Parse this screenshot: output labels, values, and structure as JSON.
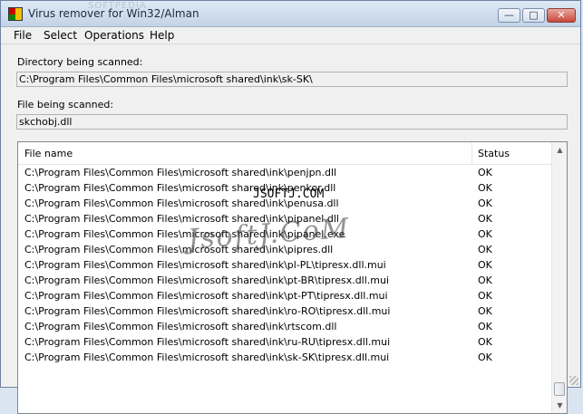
{
  "window": {
    "title": "Virus remover for Win32/Alman",
    "title_watermark": "SOFTPEDIA",
    "buttons": {
      "minimize": "—",
      "maximize": "□",
      "close": "✕"
    }
  },
  "menu": {
    "items": [
      "File",
      "Select",
      "Operations",
      "Help"
    ]
  },
  "scan": {
    "dir_label": "Directory being scanned:",
    "dir_value": "C:\\Program Files\\Common Files\\microsoft shared\\ink\\sk-SK\\",
    "file_label": "File being scanned:",
    "file_value": "skchobj.dll"
  },
  "list": {
    "columns": {
      "name": "File name",
      "status": "Status"
    },
    "rows": [
      {
        "name": "C:\\Program Files\\Common Files\\microsoft shared\\ink\\penjpn.dll",
        "status": "OK"
      },
      {
        "name": "C:\\Program Files\\Common Files\\microsoft shared\\ink\\penkor.dll",
        "status": "OK"
      },
      {
        "name": "C:\\Program Files\\Common Files\\microsoft shared\\ink\\penusa.dll",
        "status": "OK"
      },
      {
        "name": "C:\\Program Files\\Common Files\\microsoft shared\\ink\\pipanel.dll",
        "status": "OK"
      },
      {
        "name": "C:\\Program Files\\Common Files\\microsoft shared\\ink\\pipanel.exe",
        "status": "OK"
      },
      {
        "name": "C:\\Program Files\\Common Files\\microsoft shared\\ink\\pipres.dll",
        "status": "OK"
      },
      {
        "name": "C:\\Program Files\\Common Files\\microsoft shared\\ink\\pl-PL\\tipresx.dll.mui",
        "status": "OK"
      },
      {
        "name": "C:\\Program Files\\Common Files\\microsoft shared\\ink\\pt-BR\\tipresx.dll.mui",
        "status": "OK"
      },
      {
        "name": "C:\\Program Files\\Common Files\\microsoft shared\\ink\\pt-PT\\tipresx.dll.mui",
        "status": "OK"
      },
      {
        "name": "C:\\Program Files\\Common Files\\microsoft shared\\ink\\ro-RO\\tipresx.dll.mui",
        "status": "OK"
      },
      {
        "name": "C:\\Program Files\\Common Files\\microsoft shared\\ink\\rtscom.dll",
        "status": "OK"
      },
      {
        "name": "C:\\Program Files\\Common Files\\microsoft shared\\ink\\ru-RU\\tipresx.dll.mui",
        "status": "OK"
      },
      {
        "name": "C:\\Program Files\\Common Files\\microsoft shared\\ink\\sk-SK\\tipresx.dll.mui",
        "status": "OK"
      }
    ]
  },
  "scrollbar": {
    "up": "▲",
    "down": "▼"
  },
  "watermarks": {
    "text1": "JSOFTJ.COM",
    "text2": "JsoftJ.CoM"
  }
}
